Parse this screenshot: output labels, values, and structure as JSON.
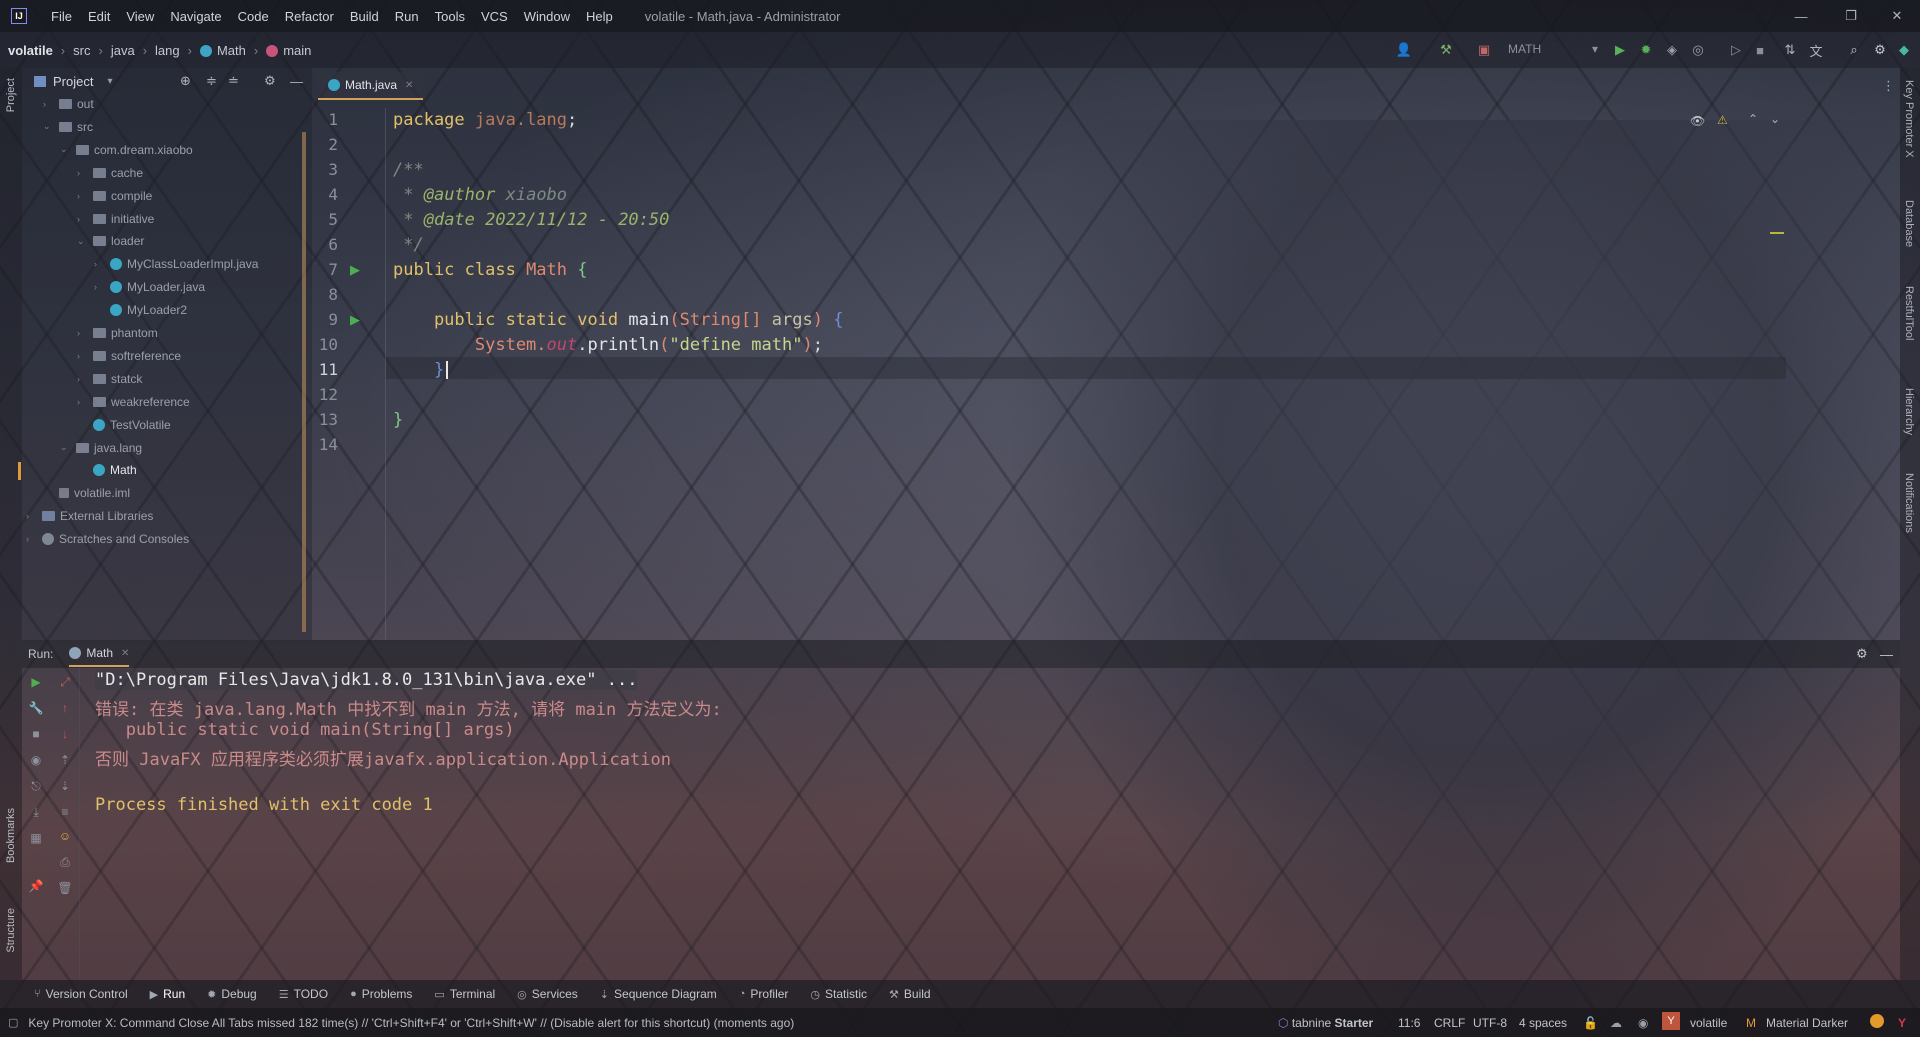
{
  "window": {
    "title": "volatile - Math.java - Administrator",
    "menu": [
      "File",
      "Edit",
      "View",
      "Navigate",
      "Code",
      "Refactor",
      "Build",
      "Run",
      "Tools",
      "VCS",
      "Window",
      "Help"
    ],
    "controls": {
      "minimize": "—",
      "restore": "❐",
      "close": "✕"
    }
  },
  "breadcrumb": {
    "project": "volatile",
    "items": [
      "src",
      "java",
      "lang",
      "Math",
      "main"
    ]
  },
  "toolbar": {
    "run_config": "MATH"
  },
  "left_strip": {
    "project_tab": "Project",
    "bookmarks_tab": "Bookmarks",
    "structure_tab": "Structure"
  },
  "right_strip": [
    "Key Promoter X",
    "Database",
    "RestfulTool",
    "Hierarchy",
    "Notifications"
  ],
  "project_panel": {
    "title": "Project",
    "tree": [
      {
        "label": "out",
        "kind": "folder",
        "depth": 1,
        "arrow": "›"
      },
      {
        "label": "src",
        "kind": "folder",
        "depth": 1,
        "arrow": "⌄"
      },
      {
        "label": "com.dream.xiaobo",
        "kind": "folder",
        "depth": 2,
        "arrow": "⌄"
      },
      {
        "label": "cache",
        "kind": "folder",
        "depth": 3,
        "arrow": "›"
      },
      {
        "label": "compile",
        "kind": "folder",
        "depth": 3,
        "arrow": "›"
      },
      {
        "label": "initiative",
        "kind": "folder",
        "depth": 3,
        "arrow": "›"
      },
      {
        "label": "loader",
        "kind": "folder",
        "depth": 3,
        "arrow": "⌄"
      },
      {
        "label": "MyClassLoaderImpl.java",
        "kind": "java",
        "depth": 4,
        "arrow": "›"
      },
      {
        "label": "MyLoader.java",
        "kind": "java",
        "depth": 4,
        "arrow": "›"
      },
      {
        "label": "MyLoader2",
        "kind": "class",
        "depth": 4,
        "arrow": ""
      },
      {
        "label": "phantom",
        "kind": "folder",
        "depth": 3,
        "arrow": "›"
      },
      {
        "label": "softreference",
        "kind": "folder",
        "depth": 3,
        "arrow": "›"
      },
      {
        "label": "statck",
        "kind": "folder",
        "depth": 3,
        "arrow": "›"
      },
      {
        "label": "weakreference",
        "kind": "folder",
        "depth": 3,
        "arrow": "›"
      },
      {
        "label": "TestVolatile",
        "kind": "class",
        "depth": 3,
        "arrow": ""
      },
      {
        "label": "java.lang",
        "kind": "folder",
        "depth": 2,
        "arrow": "⌄"
      },
      {
        "label": "Math",
        "kind": "class",
        "depth": 3,
        "arrow": ""
      },
      {
        "label": "volatile.iml",
        "kind": "iml",
        "depth": 1,
        "arrow": ""
      },
      {
        "label": "External Libraries",
        "kind": "lib",
        "depth": 0,
        "arrow": "›"
      },
      {
        "label": "Scratches and Consoles",
        "kind": "scratch",
        "depth": 0,
        "arrow": "›"
      }
    ]
  },
  "editor": {
    "tab": "Math.java",
    "line_numbers": [
      "1",
      "2",
      "3",
      "4",
      "5",
      "6",
      "7",
      "8",
      "9",
      "10",
      "11",
      "12",
      "13",
      "14"
    ],
    "code": {
      "l1_kw": "package ",
      "l1_pkg": "java.lang",
      "l1_end": ";",
      "l3": "/**",
      "l4_star": " * ",
      "l4_tag": "@author",
      "l4_val": " xiaobo",
      "l5_star": " * ",
      "l5_tag": "@date",
      "l5_val": " 2022/11/12 - 20:50",
      "l6": " */",
      "l7_kw": "public class ",
      "l7_cls": "Math",
      "l7_brace": " {",
      "l9_kw": "    public static void ",
      "l9_fn": "main",
      "l9_p1": "(",
      "l9_type": "String",
      "l9_arr": "[]",
      "l9_arg": " args",
      "l9_p2": ") ",
      "l9_brace": "{",
      "l10_sys": "        System.",
      "l10_out": "out",
      "l10_call": ".println",
      "l10_p1": "(",
      "l10_str": "\"define math\"",
      "l10_p2": ")",
      "l10_end": ";",
      "l11": "    }",
      "l13": "}"
    }
  },
  "run_panel": {
    "label": "Run:",
    "tab": "Math",
    "output": [
      "\"D:\\Program Files\\Java\\jdk1.8.0_131\\bin\\java.exe\" ...",
      "错误: 在类 java.lang.Math 中找不到 main 方法, 请将 main 方法定义为:",
      "   public static void main(String[] args)",
      "否则 JavaFX 应用程序类必须扩展javafx.application.Application",
      "",
      "Process finished with exit code 1"
    ]
  },
  "bottom_tools": [
    {
      "label": "Version Control",
      "icon": "⑂"
    },
    {
      "label": "Run",
      "icon": "▶"
    },
    {
      "label": "Debug",
      "icon": "✹"
    },
    {
      "label": "TODO",
      "icon": "☰"
    },
    {
      "label": "Problems",
      "icon": "●"
    },
    {
      "label": "Terminal",
      "icon": "▭"
    },
    {
      "label": "Services",
      "icon": "◎"
    },
    {
      "label": "Sequence Diagram",
      "icon": "⇣"
    },
    {
      "label": "Profiler",
      "icon": "◔"
    },
    {
      "label": "Statistic",
      "icon": "◷"
    },
    {
      "label": "Build",
      "icon": "⚒"
    }
  ],
  "status": {
    "message": "Key Promoter X: Command Close All Tabs missed 182 time(s) // 'Ctrl+Shift+F4' or 'Ctrl+Shift+W' // (Disable alert for this shortcut) (moments ago)",
    "tabnine": "tabnine",
    "tabnine_plan": "Starter",
    "position": "11:6",
    "line_sep": "CRLF",
    "encoding": "UTF-8",
    "indent": "4 spaces",
    "vcs_project": "volatile",
    "theme": "Material Darker"
  },
  "colors": {
    "accent": "#d2a25c",
    "keyword": "#e0c069",
    "class_icon": "#3fa3c6",
    "run_green": "#4caf50",
    "error_red": "#c75a5a"
  }
}
